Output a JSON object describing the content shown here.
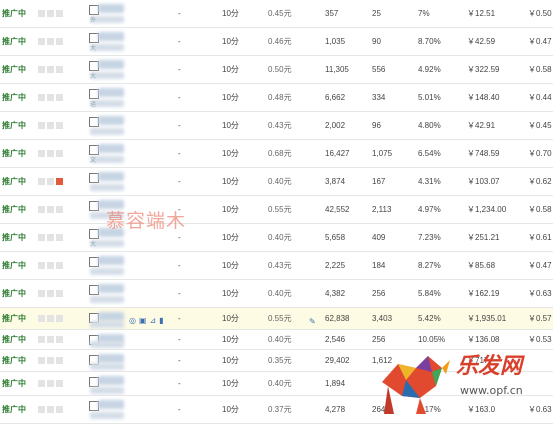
{
  "rows": [
    {
      "status": "推广中",
      "duration": "10分",
      "price": "0.45元",
      "impressions": "357",
      "clicks": "25",
      "ctr": "7%",
      "cost": "￥12.51",
      "cpc": "￥0.50",
      "dash": "-",
      "sub": "外"
    },
    {
      "status": "推广中",
      "duration": "10分",
      "price": "0.46元",
      "impressions": "1,035",
      "clicks": "90",
      "ctr": "8.70%",
      "cost": "￥42.59",
      "cpc": "￥0.47",
      "dash": "-",
      "sub": "大"
    },
    {
      "status": "推广中",
      "duration": "10分",
      "price": "0.50元",
      "impressions": "11,305",
      "clicks": "556",
      "ctr": "4.92%",
      "cost": "￥322.59",
      "cpc": "￥0.58",
      "dash": "-",
      "sub": "大"
    },
    {
      "status": "推广中",
      "duration": "10分",
      "price": "0.48元",
      "impressions": "6,662",
      "clicks": "334",
      "ctr": "5.01%",
      "cost": "￥148.40",
      "cpc": "￥0.44",
      "dash": "-",
      "sub": "运"
    },
    {
      "status": "推广中",
      "duration": "10分",
      "price": "0.43元",
      "impressions": "2,002",
      "clicks": "96",
      "ctr": "4.80%",
      "cost": "￥42.91",
      "cpc": "￥0.45",
      "dash": "-",
      "sub": ""
    },
    {
      "status": "推广中",
      "duration": "10分",
      "price": "0.68元",
      "impressions": "16,427",
      "clicks": "1,075",
      "ctr": "6.54%",
      "cost": "￥748.59",
      "cpc": "￥0.70",
      "dash": "-",
      "sub": "文"
    },
    {
      "status": "推广中",
      "duration": "10分",
      "price": "0.40元",
      "impressions": "3,874",
      "clicks": "167",
      "ctr": "4.31%",
      "cost": "￥103.07",
      "cpc": "￥0.62",
      "dash": "-",
      "sub": ""
    },
    {
      "status": "推广中",
      "duration": "10分",
      "price": "0.55元",
      "impressions": "42,552",
      "clicks": "2,113",
      "ctr": "4.97%",
      "cost": "￥1,234.00",
      "cpc": "￥0.58",
      "dash": "-",
      "sub": ""
    },
    {
      "status": "推广中",
      "duration": "10分",
      "price": "0.40元",
      "impressions": "5,658",
      "clicks": "409",
      "ctr": "7.23%",
      "cost": "￥251.21",
      "cpc": "￥0.61",
      "dash": "-",
      "sub": "大"
    },
    {
      "status": "推广中",
      "duration": "10分",
      "price": "0.43元",
      "impressions": "2,225",
      "clicks": "184",
      "ctr": "8.27%",
      "cost": "￥85.68",
      "cpc": "￥0.47",
      "dash": "-",
      "sub": ""
    },
    {
      "status": "推广中",
      "duration": "10分",
      "price": "0.40元",
      "impressions": "4,382",
      "clicks": "256",
      "ctr": "5.84%",
      "cost": "￥162.19",
      "cpc": "￥0.63",
      "dash": "-",
      "sub": ""
    },
    {
      "status": "推广中",
      "duration": "10分",
      "price": "0.55元",
      "impressions": "62,838",
      "clicks": "3,403",
      "ctr": "5.42%",
      "cost": "￥1,935.01",
      "cpc": "￥0.57",
      "dash": "-",
      "sub": ""
    },
    {
      "status": "推广中",
      "duration": "10分",
      "price": "0.40元",
      "impressions": "2,546",
      "clicks": "256",
      "ctr": "10.05%",
      "cost": "￥136.08",
      "cpc": "￥0.53",
      "dash": "-",
      "sub": ""
    },
    {
      "status": "推广中",
      "duration": "10分",
      "price": "0.35元",
      "impressions": "29,402",
      "clicks": "1,612",
      "ctr": "",
      "cost": "￥717.",
      "cpc": "",
      "dash": "-",
      "sub": ""
    },
    {
      "status": "推广中",
      "duration": "10分",
      "price": "0.40元",
      "impressions": "1,894",
      "clicks": "",
      "ctr": "",
      "cost": "",
      "cpc": "",
      "dash": "-",
      "sub": ""
    },
    {
      "status": "推广中",
      "duration": "10分",
      "price": "0.37元",
      "impressions": "4,278",
      "clicks": "264",
      "ctr": "6.17%",
      "cost": "￥163.0",
      "cpc": "￥0.63",
      "dash": "-",
      "sub": ""
    }
  ],
  "watermark": "慕容端木",
  "logo": {
    "text": "乐发网",
    "url": "www.opf.cn"
  },
  "colors": {
    "status_green": "#2e7d32",
    "highlight_row": "#fdfbe4",
    "link_blue": "#3a6fb0"
  }
}
